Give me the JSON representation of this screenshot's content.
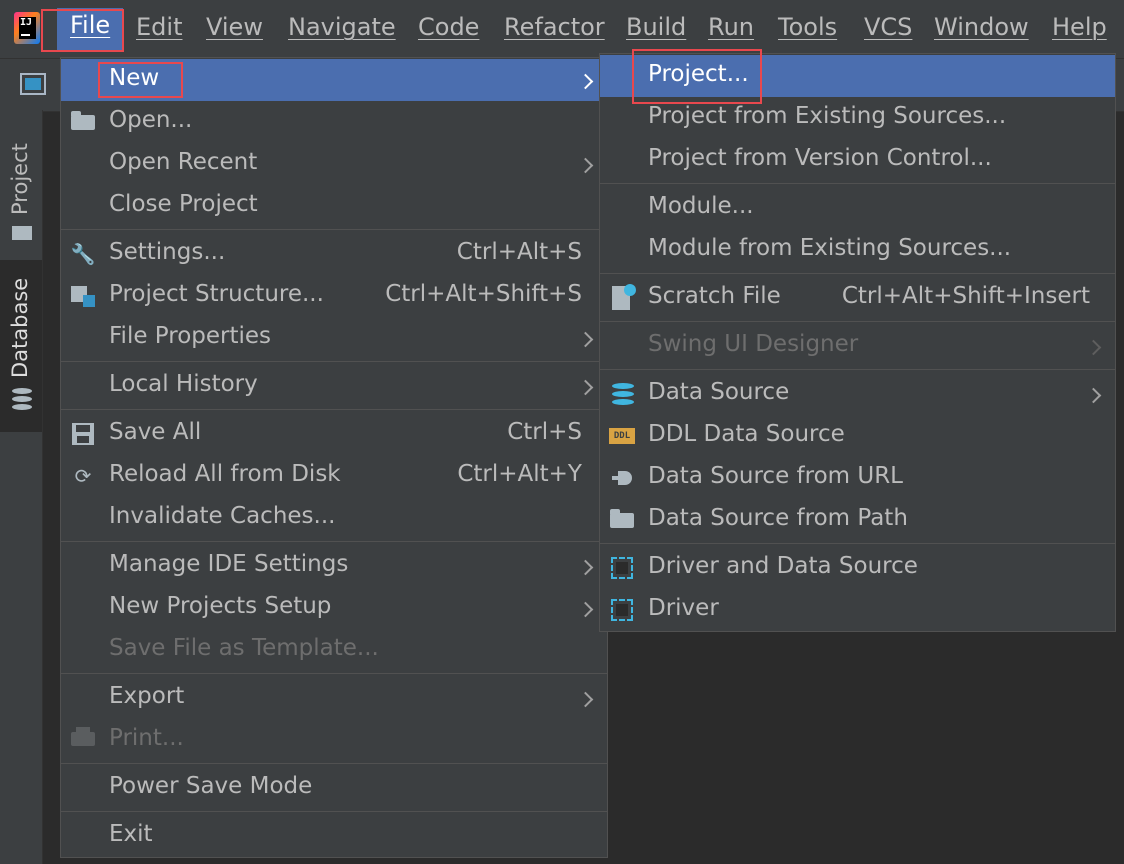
{
  "menubar": {
    "items": [
      {
        "label": "File"
      },
      {
        "label": "Edit"
      },
      {
        "label": "View"
      },
      {
        "label": "Navigate"
      },
      {
        "label": "Code"
      },
      {
        "label": "Refactor"
      },
      {
        "label": "Build"
      },
      {
        "label": "Run"
      },
      {
        "label": "Tools"
      },
      {
        "label": "VCS"
      },
      {
        "label": "Window"
      },
      {
        "label": "Help"
      }
    ]
  },
  "logo": {
    "text": "IJ"
  },
  "sidebar": {
    "tabs": [
      {
        "label": "Project"
      },
      {
        "label": "Database"
      }
    ]
  },
  "file_menu": {
    "items": [
      {
        "label": "New",
        "icon": "",
        "shortcut": "",
        "submenu": true
      },
      {
        "label": "Open...",
        "icon": "folder-icon",
        "shortcut": ""
      },
      {
        "label": "Open Recent",
        "icon": "",
        "shortcut": "",
        "submenu": true
      },
      {
        "label": "Close Project",
        "icon": "",
        "shortcut": ""
      },
      {
        "label": "Settings...",
        "icon": "wrench-icon",
        "shortcut": "Ctrl+Alt+S"
      },
      {
        "label": "Project Structure...",
        "icon": "project-structure-icon",
        "shortcut": "Ctrl+Alt+Shift+S"
      },
      {
        "label": "File Properties",
        "icon": "",
        "shortcut": "",
        "submenu": true
      },
      {
        "label": "Local History",
        "icon": "",
        "shortcut": "",
        "submenu": true
      },
      {
        "label": "Save All",
        "icon": "save-icon",
        "shortcut": "Ctrl+S"
      },
      {
        "label": "Reload All from Disk",
        "icon": "reload-icon",
        "shortcut": "Ctrl+Alt+Y"
      },
      {
        "label": "Invalidate Caches...",
        "icon": "",
        "shortcut": ""
      },
      {
        "label": "Manage IDE Settings",
        "icon": "",
        "shortcut": "",
        "submenu": true
      },
      {
        "label": "New Projects Setup",
        "icon": "",
        "shortcut": "",
        "submenu": true
      },
      {
        "label": "Save File as Template...",
        "icon": "",
        "shortcut": "",
        "disabled": true
      },
      {
        "label": "Export",
        "icon": "",
        "shortcut": "",
        "submenu": true
      },
      {
        "label": "Print...",
        "icon": "print-icon",
        "shortcut": "",
        "disabled": true
      },
      {
        "label": "Power Save Mode",
        "icon": "",
        "shortcut": ""
      },
      {
        "label": "Exit",
        "icon": "",
        "shortcut": ""
      }
    ]
  },
  "new_submenu": {
    "items": [
      {
        "label": "Project...",
        "icon": "",
        "shortcut": ""
      },
      {
        "label": "Project from Existing Sources...",
        "icon": "",
        "shortcut": ""
      },
      {
        "label": "Project from Version Control...",
        "icon": "",
        "shortcut": ""
      },
      {
        "label": "Module...",
        "icon": "",
        "shortcut": ""
      },
      {
        "label": "Module from Existing Sources...",
        "icon": "",
        "shortcut": ""
      },
      {
        "label": "Scratch File",
        "icon": "scratch-file-icon",
        "shortcut": "Ctrl+Alt+Shift+Insert"
      },
      {
        "label": "Swing UI Designer",
        "icon": "",
        "shortcut": "",
        "submenu": true,
        "disabled": true
      },
      {
        "label": "Data Source",
        "icon": "database-icon",
        "shortcut": "",
        "submenu": true
      },
      {
        "label": "DDL Data Source",
        "icon": "ddl-icon",
        "shortcut": ""
      },
      {
        "label": "Data Source from URL",
        "icon": "plug-icon",
        "shortcut": ""
      },
      {
        "label": "Data Source from Path",
        "icon": "folder-icon",
        "shortcut": ""
      },
      {
        "label": "Driver and Data Source",
        "icon": "driver-icon",
        "shortcut": ""
      },
      {
        "label": "Driver",
        "icon": "driver-icon",
        "shortcut": ""
      }
    ]
  },
  "ddl_icon_text": "DDL",
  "colors": {
    "highlight": "#4b6eaf",
    "annotation": "#e8484e",
    "menu_bg": "#3c3f41",
    "accent": "#40b6e0"
  }
}
